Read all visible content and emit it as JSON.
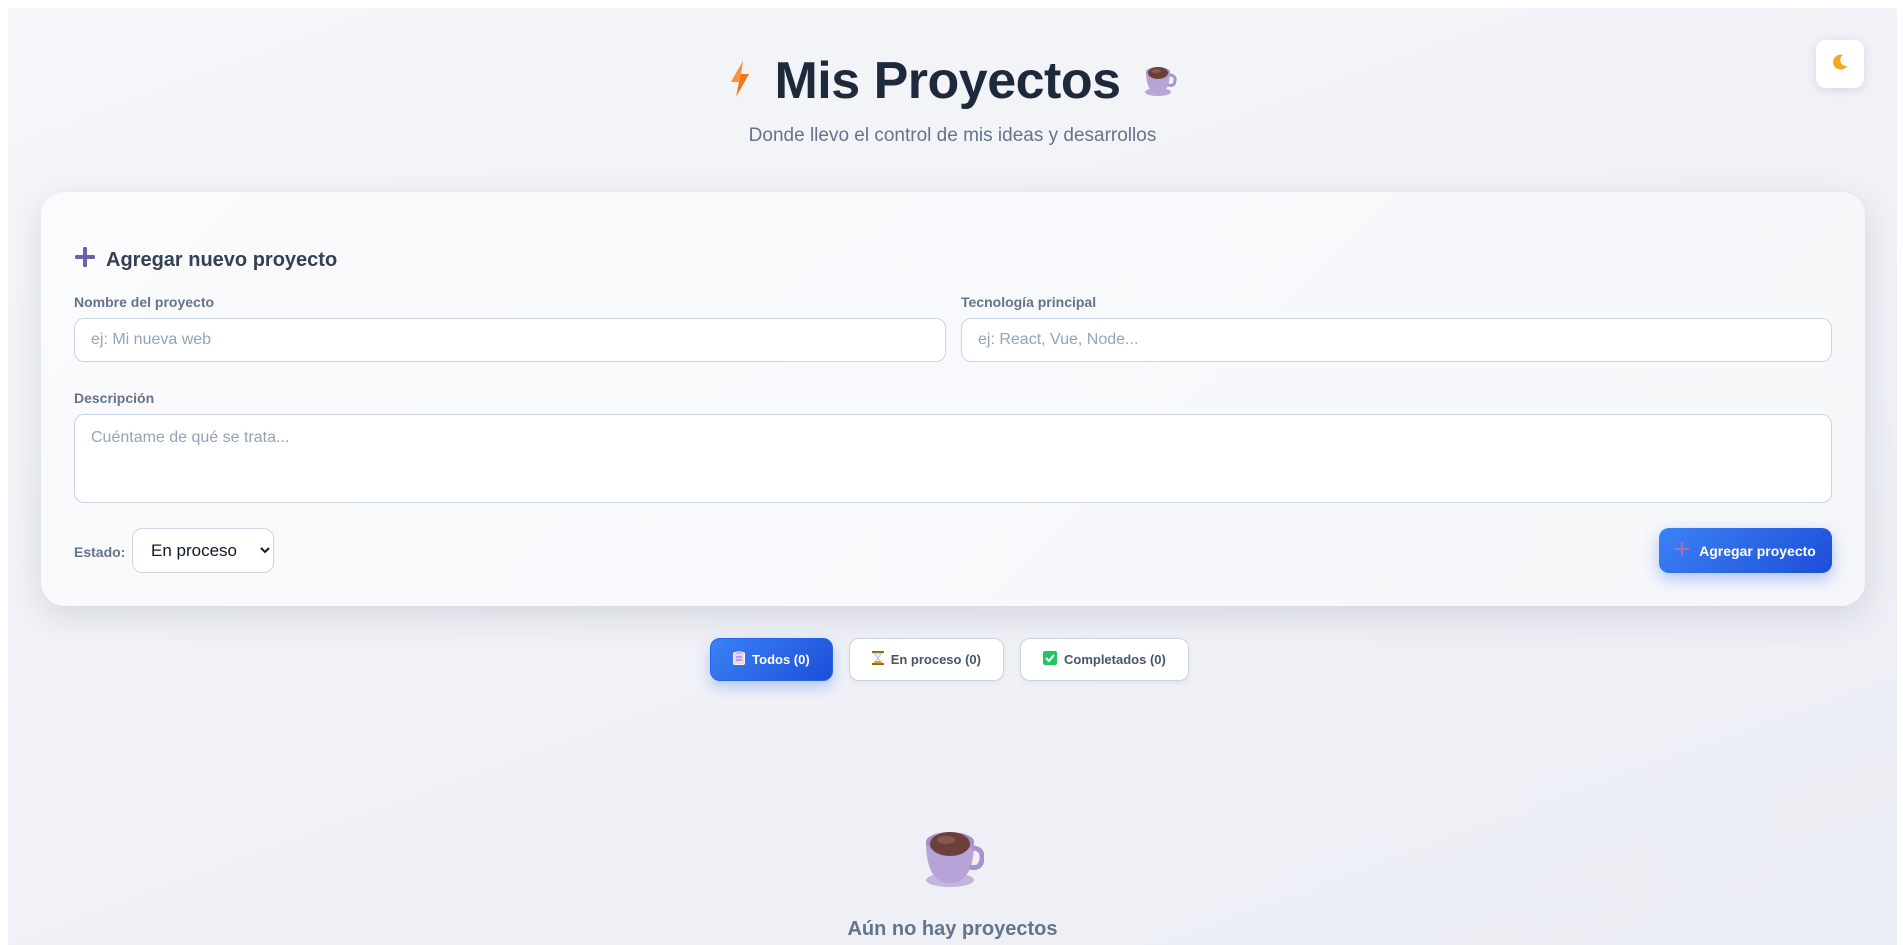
{
  "header": {
    "title": "Mis Proyectos",
    "subtitle": "Donde llevo el control de mis ideas y desarrollos",
    "left_icon": "lightning-icon",
    "right_icon": "coffee-cup-icon"
  },
  "theme_toggle": {
    "icon": "moon-icon"
  },
  "form": {
    "title": "Agregar nuevo proyecto",
    "name_label": "Nombre del proyecto",
    "name_placeholder": "ej: Mi nueva web",
    "tech_label": "Tecnología principal",
    "tech_placeholder": "ej: React, Vue, Node...",
    "description_label": "Descripción",
    "description_placeholder": "Cuéntame de qué se trata...",
    "status_label": "Estado:",
    "status_selected": "En proceso",
    "status_options": [
      "En proceso"
    ],
    "submit_label": "Agregar proyecto"
  },
  "filters": [
    {
      "label": "Todos (0)",
      "icon": "clipboard-icon",
      "active": true
    },
    {
      "label": "En proceso (0)",
      "icon": "hourglass-icon",
      "active": false
    },
    {
      "label": "Completados (0)",
      "icon": "check-box-icon",
      "active": false
    }
  ],
  "empty_state": {
    "icon": "coffee-cup-icon",
    "message": "Aún no hay proyectos"
  },
  "colors": {
    "accent": "#2563eb",
    "title": "#1e293b",
    "muted": "#64748b",
    "plus_icon": "#6d5fa8"
  }
}
